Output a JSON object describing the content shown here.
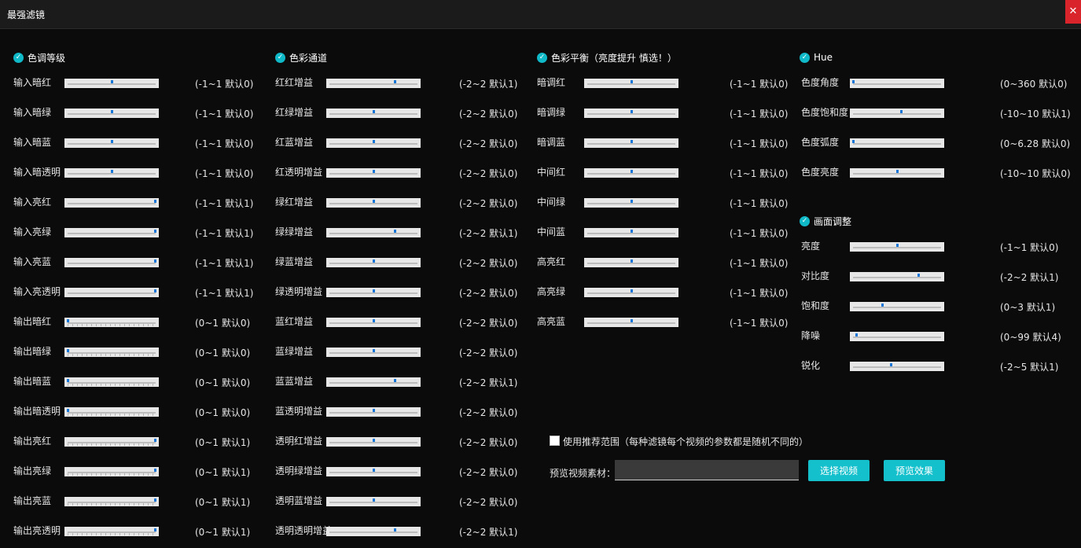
{
  "window": {
    "title": "最强滤镜",
    "close_icon": "close-icon",
    "close_symbol": "✕"
  },
  "accent_color": "#14c0cc",
  "check_symbol": "✓",
  "sections": [
    {
      "title": "色调等级",
      "rows": [
        {
          "label": "输入暗红",
          "range": "(-1~1 默认0)",
          "min": -1,
          "max": 1,
          "value": 0,
          "ticks": false
        },
        {
          "label": "输入暗绿",
          "range": "(-1~1 默认0)",
          "min": -1,
          "max": 1,
          "value": 0,
          "ticks": false
        },
        {
          "label": "输入暗蓝",
          "range": "(-1~1 默认0)",
          "min": -1,
          "max": 1,
          "value": 0,
          "ticks": false
        },
        {
          "label": "输入暗透明",
          "range": "(-1~1 默认0)",
          "min": -1,
          "max": 1,
          "value": 0,
          "ticks": false
        },
        {
          "label": "输入亮红",
          "range": "(-1~1 默认1)",
          "min": -1,
          "max": 1,
          "value": 1,
          "ticks": false
        },
        {
          "label": "输入亮绿",
          "range": "(-1~1 默认1)",
          "min": -1,
          "max": 1,
          "value": 1,
          "ticks": false
        },
        {
          "label": "输入亮蓝",
          "range": "(-1~1 默认1)",
          "min": -1,
          "max": 1,
          "value": 1,
          "ticks": false
        },
        {
          "label": "输入亮透明",
          "range": "(-1~1 默认1)",
          "min": -1,
          "max": 1,
          "value": 1,
          "ticks": false
        },
        {
          "label": "输出暗红",
          "range": "(0~1 默认0)",
          "min": 0,
          "max": 1,
          "value": 0,
          "ticks": true
        },
        {
          "label": "输出暗绿",
          "range": "(0~1 默认0)",
          "min": 0,
          "max": 1,
          "value": 0,
          "ticks": true
        },
        {
          "label": "输出暗蓝",
          "range": "(0~1 默认0)",
          "min": 0,
          "max": 1,
          "value": 0,
          "ticks": true
        },
        {
          "label": "输出暗透明",
          "range": "(0~1 默认0)",
          "min": 0,
          "max": 1,
          "value": 0,
          "ticks": true
        },
        {
          "label": "输出亮红",
          "range": "(0~1 默认1)",
          "min": 0,
          "max": 1,
          "value": 1,
          "ticks": true
        },
        {
          "label": "输出亮绿",
          "range": "(0~1 默认1)",
          "min": 0,
          "max": 1,
          "value": 1,
          "ticks": true
        },
        {
          "label": "输出亮蓝",
          "range": "(0~1 默认1)",
          "min": 0,
          "max": 1,
          "value": 1,
          "ticks": true
        },
        {
          "label": "输出亮透明",
          "range": "(0~1 默认1)",
          "min": 0,
          "max": 1,
          "value": 1,
          "ticks": true
        }
      ]
    },
    {
      "title": "色彩通道",
      "rows": [
        {
          "label": "红红增益",
          "range": "(-2~2 默认1)",
          "min": -2,
          "max": 2,
          "value": 1,
          "ticks": false
        },
        {
          "label": "红绿增益",
          "range": "(-2~2 默认0)",
          "min": -2,
          "max": 2,
          "value": 0,
          "ticks": false
        },
        {
          "label": "红蓝增益",
          "range": "(-2~2 默认0)",
          "min": -2,
          "max": 2,
          "value": 0,
          "ticks": false
        },
        {
          "label": "红透明增益",
          "range": "(-2~2 默认0)",
          "min": -2,
          "max": 2,
          "value": 0,
          "ticks": false
        },
        {
          "label": "绿红增益",
          "range": "(-2~2 默认0)",
          "min": -2,
          "max": 2,
          "value": 0,
          "ticks": false
        },
        {
          "label": "绿绿增益",
          "range": "(-2~2 默认1)",
          "min": -2,
          "max": 2,
          "value": 1,
          "ticks": false
        },
        {
          "label": "绿蓝增益",
          "range": "(-2~2 默认0)",
          "min": -2,
          "max": 2,
          "value": 0,
          "ticks": false
        },
        {
          "label": "绿透明增益",
          "range": "(-2~2 默认0)",
          "min": -2,
          "max": 2,
          "value": 0,
          "ticks": false
        },
        {
          "label": "蓝红增益",
          "range": "(-2~2 默认0)",
          "min": -2,
          "max": 2,
          "value": 0,
          "ticks": false
        },
        {
          "label": "蓝绿增益",
          "range": "(-2~2 默认0)",
          "min": -2,
          "max": 2,
          "value": 0,
          "ticks": false
        },
        {
          "label": "蓝蓝增益",
          "range": "(-2~2 默认1)",
          "min": -2,
          "max": 2,
          "value": 1,
          "ticks": false
        },
        {
          "label": "蓝透明增益",
          "range": "(-2~2 默认0)",
          "min": -2,
          "max": 2,
          "value": 0,
          "ticks": false
        },
        {
          "label": "透明红增益",
          "range": "(-2~2 默认0)",
          "min": -2,
          "max": 2,
          "value": 0,
          "ticks": false
        },
        {
          "label": "透明绿增益",
          "range": "(-2~2 默认0)",
          "min": -2,
          "max": 2,
          "value": 0,
          "ticks": false
        },
        {
          "label": "透明蓝增益",
          "range": "(-2~2 默认0)",
          "min": -2,
          "max": 2,
          "value": 0,
          "ticks": false
        },
        {
          "label": "透明透明增益",
          "range": "(-2~2 默认1)",
          "min": -2,
          "max": 2,
          "value": 1,
          "ticks": false
        }
      ]
    },
    {
      "title": "色彩平衡（亮度提升 慎选！）",
      "rows": [
        {
          "label": "暗调红",
          "range": "(-1~1 默认0)",
          "min": -1,
          "max": 1,
          "value": 0,
          "ticks": false
        },
        {
          "label": "暗调绿",
          "range": "(-1~1 默认0)",
          "min": -1,
          "max": 1,
          "value": 0,
          "ticks": false
        },
        {
          "label": "暗调蓝",
          "range": "(-1~1 默认0)",
          "min": -1,
          "max": 1,
          "value": 0,
          "ticks": false
        },
        {
          "label": "中间红",
          "range": "(-1~1 默认0)",
          "min": -1,
          "max": 1,
          "value": 0,
          "ticks": false
        },
        {
          "label": "中间绿",
          "range": "(-1~1 默认0)",
          "min": -1,
          "max": 1,
          "value": 0,
          "ticks": false
        },
        {
          "label": "中间蓝",
          "range": "(-1~1 默认0)",
          "min": -1,
          "max": 1,
          "value": 0,
          "ticks": false
        },
        {
          "label": "高亮红",
          "range": "(-1~1 默认0)",
          "min": -1,
          "max": 1,
          "value": 0,
          "ticks": false
        },
        {
          "label": "高亮绿",
          "range": "(-1~1 默认0)",
          "min": -1,
          "max": 1,
          "value": 0,
          "ticks": false
        },
        {
          "label": "高亮蓝",
          "range": "(-1~1 默认0)",
          "min": -1,
          "max": 1,
          "value": 0,
          "ticks": false
        }
      ]
    },
    {
      "title": "Hue",
      "rows": [
        {
          "label": "色度角度",
          "range": "(0~360 默认0)",
          "min": 0,
          "max": 360,
          "value": 0,
          "ticks": false
        },
        {
          "label": "色度饱和度",
          "range": "(-10~10 默认1)",
          "min": -10,
          "max": 10,
          "value": 1,
          "ticks": false
        },
        {
          "label": "色度弧度",
          "range": "(0~6.28 默认0)",
          "min": 0,
          "max": 6.28,
          "value": 0,
          "ticks": false
        },
        {
          "label": "色度亮度",
          "range": "(-10~10 默认0)",
          "min": -10,
          "max": 10,
          "value": 0,
          "ticks": false
        }
      ]
    },
    {
      "title": "画面调整",
      "rows": [
        {
          "label": "亮度",
          "range": "(-1~1 默认0)",
          "min": -1,
          "max": 1,
          "value": 0,
          "ticks": false
        },
        {
          "label": "对比度",
          "range": "(-2~2 默认1)",
          "min": -2,
          "max": 2,
          "value": 1,
          "ticks": false
        },
        {
          "label": "饱和度",
          "range": "(0~3 默认1)",
          "min": 0,
          "max": 3,
          "value": 1,
          "ticks": false
        },
        {
          "label": "降噪",
          "range": "(0~99 默认4)",
          "min": 0,
          "max": 99,
          "value": 4,
          "ticks": false
        },
        {
          "label": "锐化",
          "range": "(-2~5 默认1)",
          "min": -2,
          "max": 5,
          "value": 1,
          "ticks": false
        }
      ]
    }
  ],
  "bottom": {
    "recommend_label": "使用推荐范围（每种滤镜每个视频的参数都是随机不同的）",
    "recommend_checked": false,
    "preview_label": "预览视频素材：",
    "preview_value": "",
    "select_video_button": "选择视频",
    "preview_button": "预览效果"
  }
}
